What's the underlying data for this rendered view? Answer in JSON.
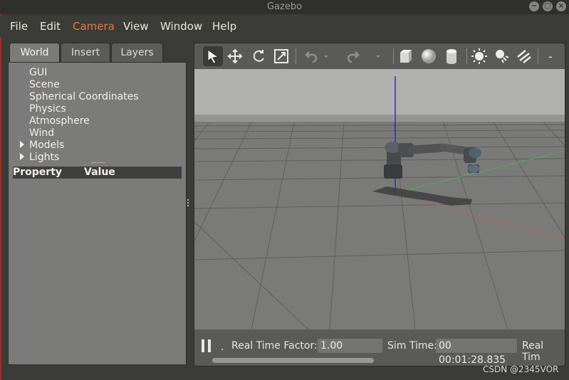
{
  "window": {
    "title": "Gazebo",
    "controls": [
      "−",
      "□",
      "×"
    ]
  },
  "menu": {
    "items": [
      {
        "label": "File"
      },
      {
        "label": "Edit"
      },
      {
        "label": "Camera"
      },
      {
        "label": "View"
      },
      {
        "label": "Window"
      },
      {
        "label": "Help"
      }
    ]
  },
  "left_panel": {
    "tabs": [
      {
        "label": "World"
      },
      {
        "label": "Insert"
      },
      {
        "label": "Layers"
      }
    ],
    "tree": {
      "items": [
        {
          "label": "GUI"
        },
        {
          "label": "Scene"
        },
        {
          "label": "Spherical Coordinates"
        },
        {
          "label": "Physics"
        },
        {
          "label": "Atmosphere"
        },
        {
          "label": "Wind"
        },
        {
          "label": "Models"
        },
        {
          "label": "Lights"
        }
      ]
    },
    "property_header": {
      "property": "Property",
      "value": "Value"
    }
  },
  "toolbar": {
    "tools": [
      "select-arrow-icon",
      "translate-icon",
      "rotate-icon",
      "scale-icon",
      "undo-icon",
      "undo-dropdown-icon",
      "redo-icon",
      "redo-dropdown-icon",
      "box-icon",
      "sphere-icon",
      "cylinder-icon",
      "point-light-icon",
      "spot-light-icon",
      "directional-light-icon",
      "more-icon"
    ],
    "more_label": "-"
  },
  "bottom_bar": {
    "play_pause": "pause-icon",
    "dot": ".",
    "real_time_factor_label": "Real Time Factor:",
    "real_time_factor_value": "1.00",
    "sim_time_label": "Sim Time:",
    "sim_time_value": "00 00:01:28.835",
    "real_time_label": "Real Tim"
  },
  "watermark": "CSDN @2345VOR",
  "colors": {
    "accent": "#e9773a",
    "menu_bg": "#3b3b37",
    "panel_bg": "#7b7b79"
  }
}
